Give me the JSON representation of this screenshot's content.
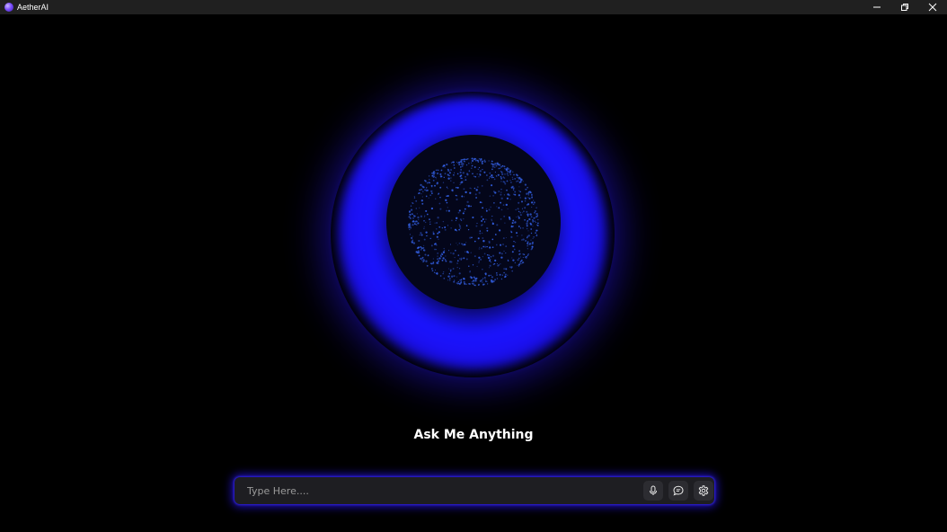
{
  "window": {
    "title": "AetherAI",
    "controls": {
      "minimize": "minimize-icon",
      "maximize": "restore-icon",
      "close": "close-icon"
    }
  },
  "orb": {
    "halo_color": "#1a14ff",
    "core_color": "#04061a",
    "particle_color": "#3a6cff"
  },
  "main": {
    "heading": "Ask Me Anything"
  },
  "input": {
    "placeholder": "Type Here....",
    "value": "",
    "accent_glow": "#2814f0"
  },
  "actions": [
    {
      "name": "mic",
      "icon": "microphone-icon"
    },
    {
      "name": "chat",
      "icon": "chat-bubble-icon"
    },
    {
      "name": "settings",
      "icon": "gear-icon"
    }
  ]
}
